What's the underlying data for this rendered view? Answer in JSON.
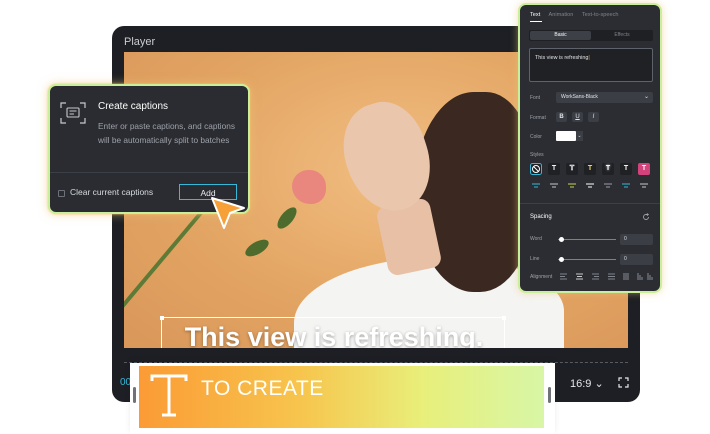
{
  "player": {
    "title": "Player",
    "caption_text": "This view is refreshing.",
    "time_current": "00",
    "aspect_ratio": "16:9",
    "aspect_chevron": "⌄"
  },
  "captions_card": {
    "title": "Create captions",
    "description": "Enter or paste captions, and captions will be automatically split to batches",
    "clear_label": "Clear current captions",
    "add_label": "Add"
  },
  "text_panel": {
    "tabs": [
      "Text",
      "Animation",
      "Text-to-speech"
    ],
    "active_tab": "Text",
    "subtabs": [
      "Basic",
      "Effects"
    ],
    "textarea_value": "This view is refreshing",
    "font_label": "Font",
    "font_value": "WorkSans-Black",
    "format_label": "Format",
    "format_buttons": [
      "B",
      "U",
      "I"
    ],
    "color_label": "Color",
    "color_value": "#ffffff",
    "styles_label": "Styles",
    "style_glyph": "T",
    "spacing_label": "Spacing",
    "word_label": "Word",
    "word_value": "0",
    "line_label": "Line",
    "line_value": "0",
    "alignment_label": "Alignment"
  },
  "template": {
    "text": "TO CREATE"
  },
  "colors": {
    "accent": "#36b8d9",
    "highlight_border": "#c9ef9a",
    "cursor": "#f6a037"
  }
}
